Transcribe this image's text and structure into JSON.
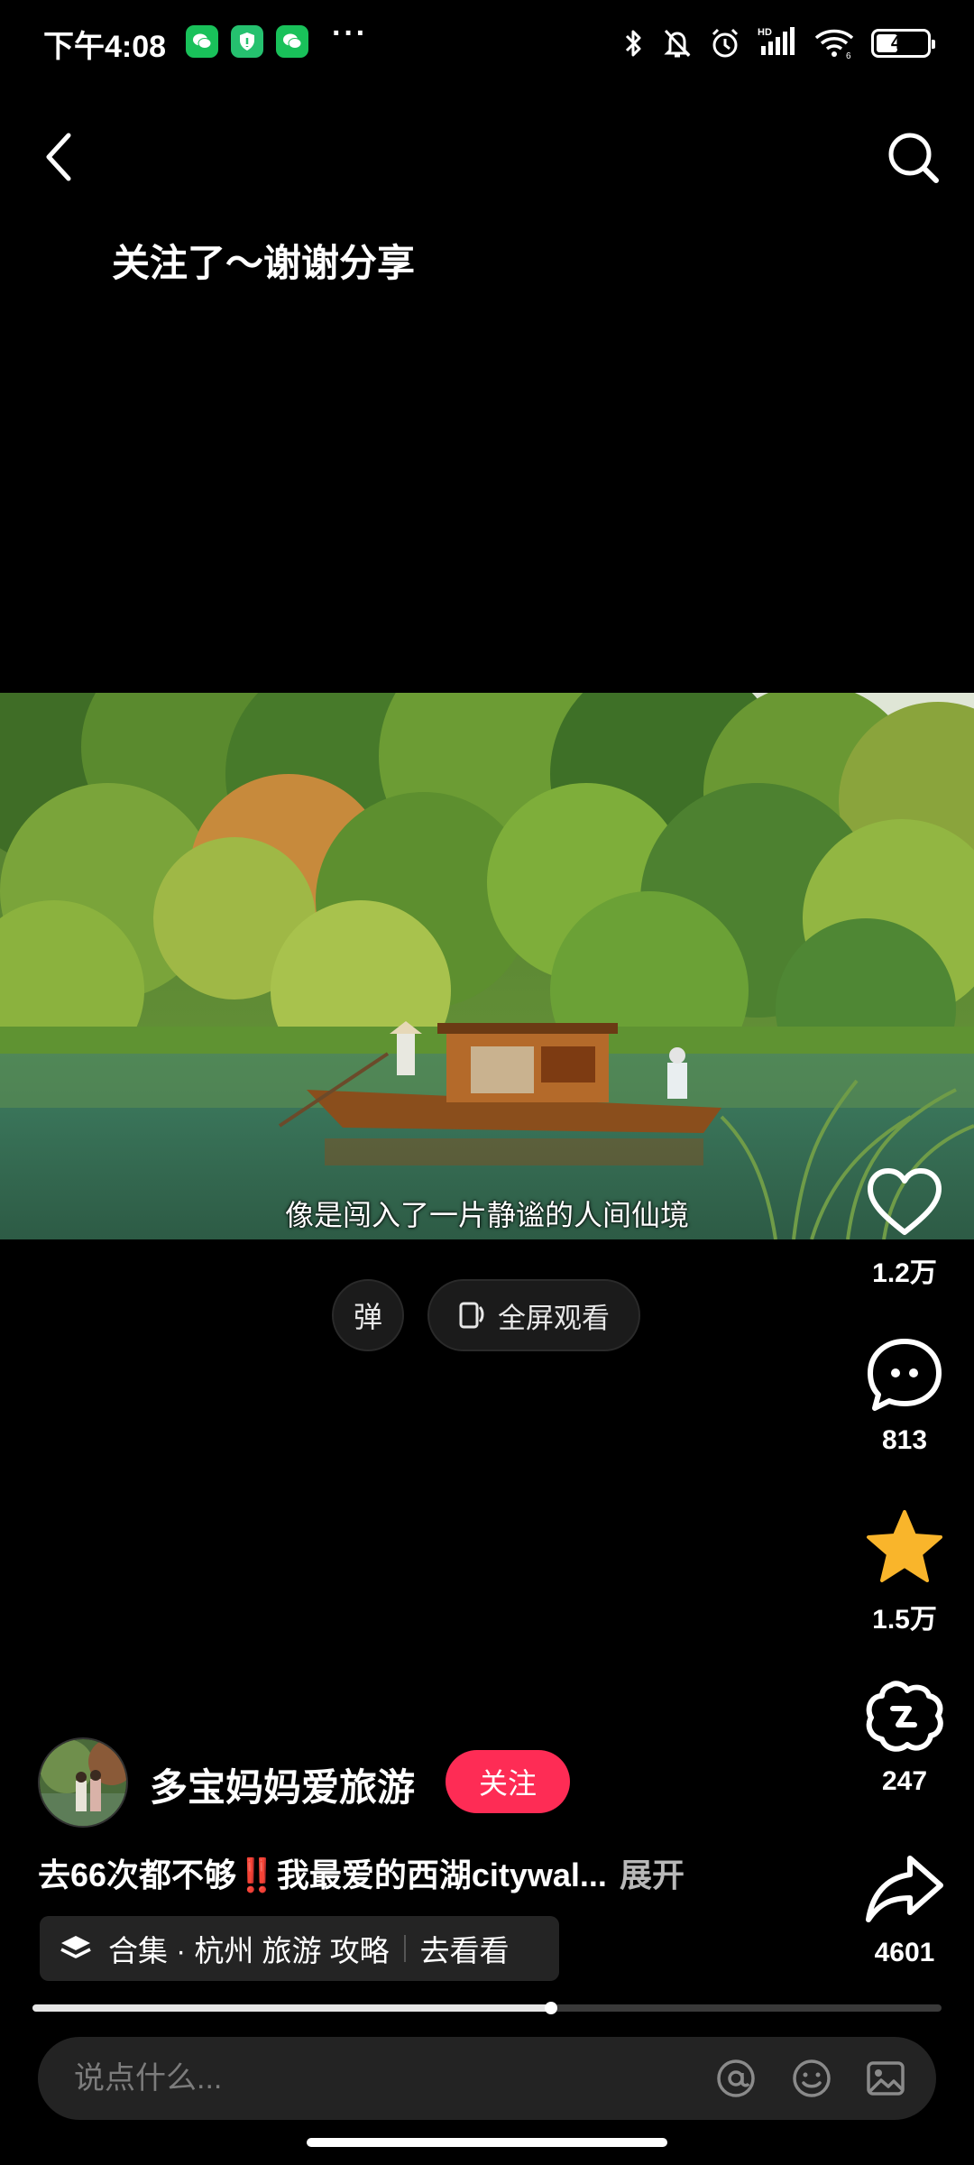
{
  "status_bar": {
    "time": "下午4:08",
    "more": "···",
    "hd": "HD",
    "battery": "43",
    "battery_level": 0.43,
    "apps": [
      "wechat-icon",
      "shield-icon",
      "wechat-icon"
    ]
  },
  "nav": {
    "back_icon": "chevron-left-icon",
    "search_icon": "search-icon"
  },
  "comment_banner": "关注了～谢谢分享",
  "video": {
    "subtitle": "像是闯入了一片静谧的人间仙境"
  },
  "controls": {
    "danmu_label": "弹",
    "fullscreen_label": "全屏观看"
  },
  "actions": {
    "like_count": "1.2万",
    "comment_count": "813",
    "favorite_count": "1.5万",
    "share_to_count": "247",
    "share_count": "4601",
    "favorite_color": "#f9b52b"
  },
  "author": {
    "name": "多宝妈妈爱旅游",
    "follow_label": "关注"
  },
  "description": {
    "text": "去66次都不够‼️我最爱的西湖citywal...",
    "expand": "展开"
  },
  "collection": {
    "label": "合集 · 杭州 旅游 攻略",
    "action": "去看看"
  },
  "progress": {
    "fraction": 0.57
  },
  "input": {
    "placeholder": "说点什么..."
  },
  "colors": {
    "accent": "#fe2c55",
    "background": "#000000"
  }
}
